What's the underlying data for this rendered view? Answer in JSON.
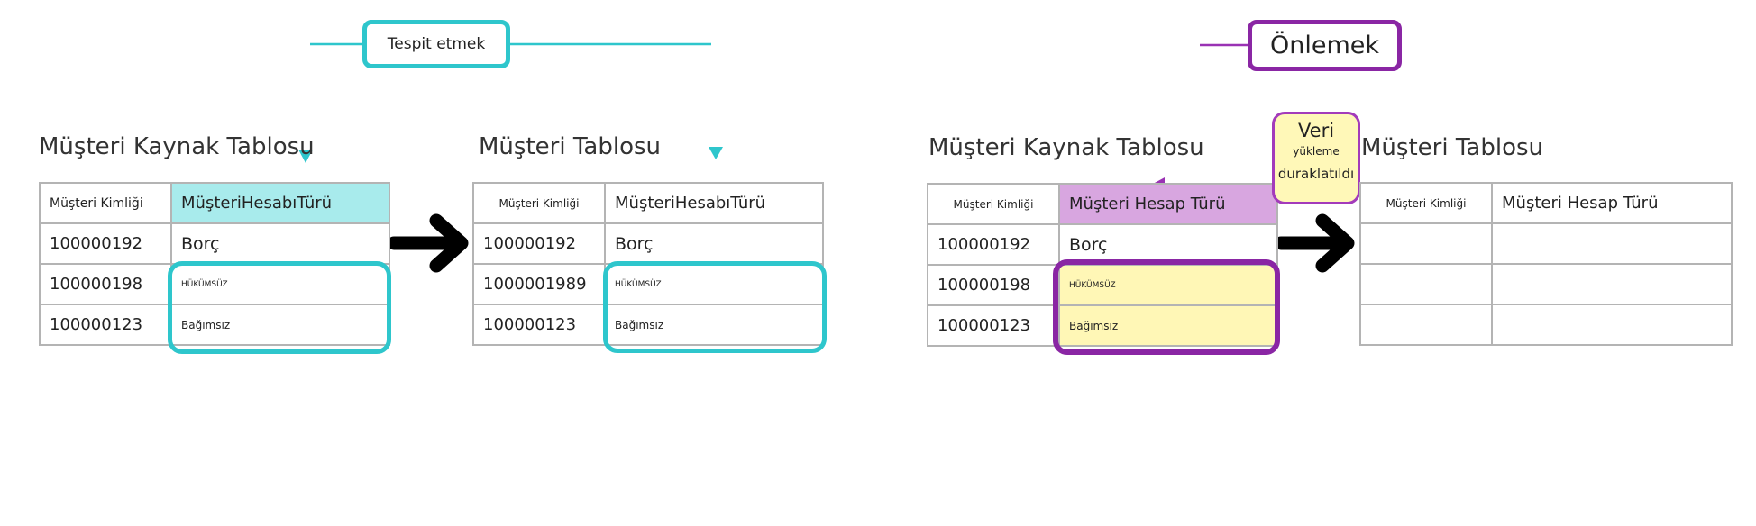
{
  "colors": {
    "cyan": "#2ec6cc",
    "purple": "#8a26a4",
    "yellow": "#fff7b6",
    "arrow": "#000000"
  },
  "detect": {
    "callout": "Tespit etmek",
    "source": {
      "title": "Müşteri Kaynak Tablosu",
      "headers": [
        "Müşteri Kimliği",
        "MüşteriHesabıTürü"
      ],
      "rows": [
        [
          "100000192",
          "Borç"
        ],
        [
          "100000198",
          "HÜKÜMSÜZ"
        ],
        [
          "100000123",
          "Bağımsız"
        ]
      ]
    },
    "target": {
      "title": "Müşteri Tablosu",
      "headers": [
        "Müşteri Kimliği",
        "MüşteriHesabıTürü"
      ],
      "rows": [
        [
          "100000192",
          "Borç"
        ],
        [
          "1000001989",
          "HÜKÜMSÜZ"
        ],
        [
          "100000123",
          "Bağımsız"
        ]
      ]
    }
  },
  "prevent": {
    "callout": "Önlemek",
    "paused_note": {
      "line1": "Veri",
      "line2": "yükleme",
      "line3": "duraklatıldı"
    },
    "source": {
      "title": "Müşteri Kaynak Tablosu",
      "headers": [
        "Müşteri Kimliği",
        "Müşteri Hesap Türü"
      ],
      "rows": [
        [
          "100000192",
          "Borç"
        ],
        [
          "100000198",
          "HÜKÜMSÜZ"
        ],
        [
          "100000123",
          "Bağımsız"
        ]
      ]
    },
    "target": {
      "title": "Müşteri Tablosu",
      "headers": [
        "Müşteri Kimliği",
        "Müşteri Hesap Türü"
      ],
      "rows": [
        [
          "",
          ""
        ],
        [
          "",
          ""
        ],
        [
          "",
          ""
        ]
      ]
    }
  }
}
